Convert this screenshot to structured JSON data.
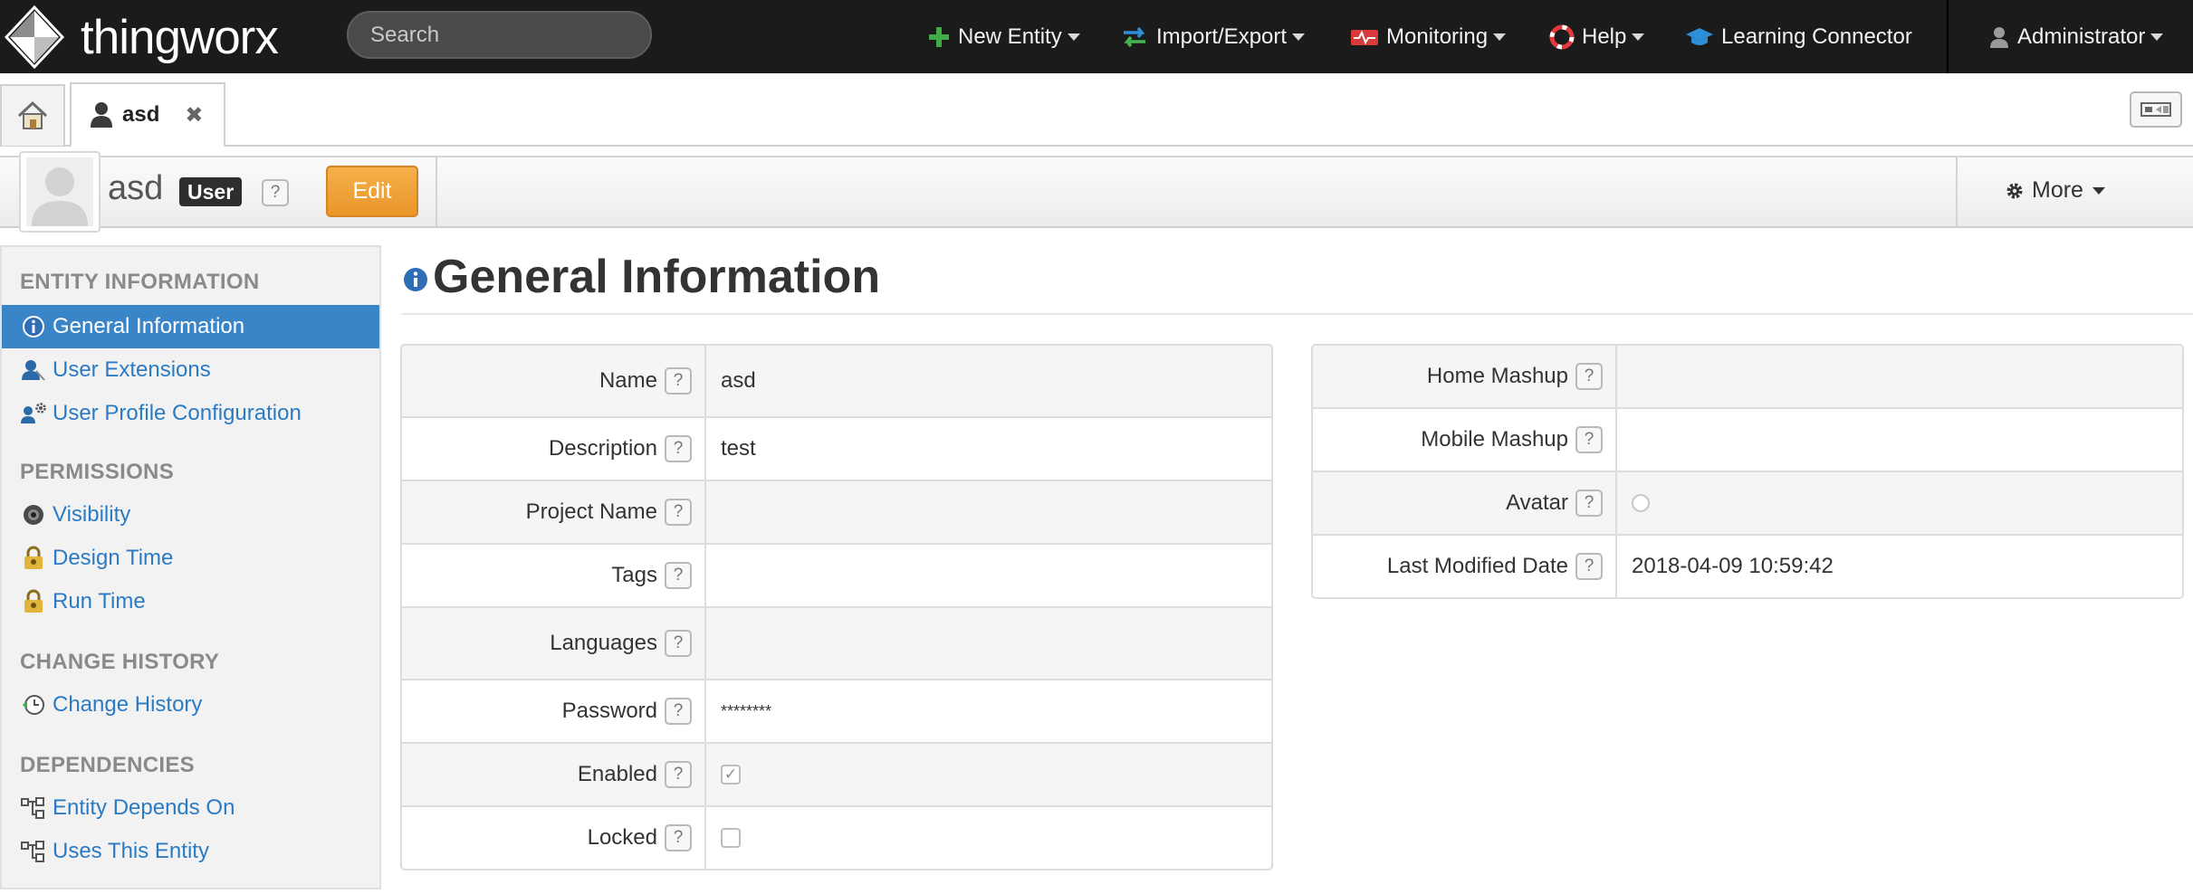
{
  "topbar": {
    "brand": "thingworx",
    "search_placeholder": "Search",
    "nav": {
      "new_entity": "New Entity",
      "import_export": "Import/Export",
      "monitoring": "Monitoring",
      "help": "Help",
      "learning_connector": "Learning Connector",
      "user": "Administrator"
    }
  },
  "tabs": {
    "active_tab_label": "asd",
    "close_glyph": "✖"
  },
  "entity": {
    "name": "asd",
    "type_badge": "User",
    "help": "?",
    "edit_label": "Edit",
    "more_label": "More"
  },
  "sidebar": {
    "sections": {
      "entity_information": "ENTITY INFORMATION",
      "permissions": "PERMISSIONS",
      "change_history": "CHANGE HISTORY",
      "dependencies": "DEPENDENCIES"
    },
    "items": {
      "general_information": "General Information",
      "user_extensions": "User Extensions",
      "user_profile_configuration": "User Profile Configuration",
      "visibility": "Visibility",
      "design_time": "Design Time",
      "run_time": "Run Time",
      "change_history": "Change History",
      "entity_depends_on": "Entity Depends On",
      "uses_this_entity": "Uses This Entity"
    }
  },
  "main": {
    "title": "General Information",
    "help": "?",
    "left_fields": [
      {
        "label": "Name",
        "value": "asd"
      },
      {
        "label": "Description",
        "value": "test"
      },
      {
        "label": "Project Name",
        "value": ""
      },
      {
        "label": "Tags",
        "value": ""
      },
      {
        "label": "Languages",
        "value": ""
      },
      {
        "label": "Password",
        "value": "********"
      },
      {
        "label": "Enabled",
        "checked": true
      },
      {
        "label": "Locked",
        "checked": false
      }
    ],
    "right_fields": [
      {
        "label": "Home Mashup",
        "value": ""
      },
      {
        "label": "Mobile Mashup",
        "value": ""
      },
      {
        "label": "Avatar",
        "value": ""
      },
      {
        "label": "Last Modified Date",
        "value": "2018-04-09 10:59:42"
      }
    ],
    "checkmark": "✓"
  }
}
